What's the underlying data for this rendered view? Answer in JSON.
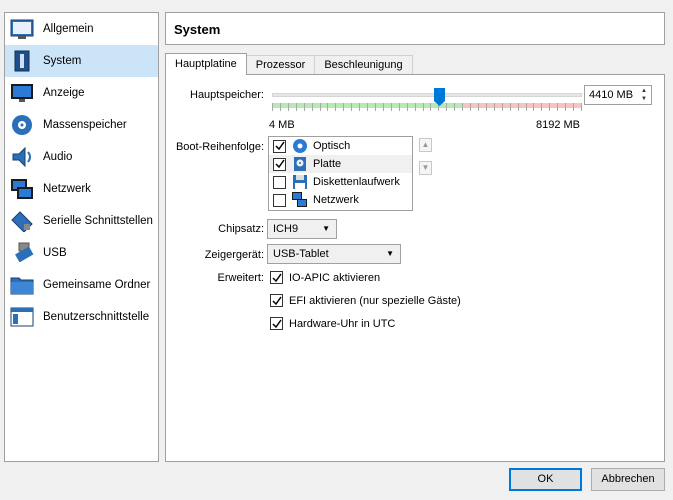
{
  "sidebar": {
    "items": [
      {
        "label": "Allgemein",
        "icon": "general-icon"
      },
      {
        "label": "System",
        "icon": "system-icon",
        "selected": true
      },
      {
        "label": "Anzeige",
        "icon": "display-icon"
      },
      {
        "label": "Massenspeicher",
        "icon": "storage-icon"
      },
      {
        "label": "Audio",
        "icon": "audio-icon"
      },
      {
        "label": "Netzwerk",
        "icon": "network-icon"
      },
      {
        "label": "Serielle Schnittstellen",
        "icon": "serial-port-icon"
      },
      {
        "label": "USB",
        "icon": "usb-icon"
      },
      {
        "label": "Gemeinsame Ordner",
        "icon": "shared-folder-icon"
      },
      {
        "label": "Benutzerschnittstelle",
        "icon": "user-interface-icon"
      }
    ]
  },
  "header": {
    "title": "System"
  },
  "tabs": [
    {
      "label": "Hauptplatine",
      "active": true
    },
    {
      "label": "Prozessor",
      "active": false
    },
    {
      "label": "Beschleunigung",
      "active": false
    }
  ],
  "motherboard": {
    "memory_label": "Hauptspeicher:",
    "memory_value": "4410 MB",
    "memory_min_label": "4 MB",
    "memory_max_label": "8192 MB",
    "memory_fraction": 0.538,
    "boot_order_label": "Boot-Reihenfolge:",
    "boot_items": [
      {
        "label": "Optisch",
        "checked": true,
        "icon": "optical-disc-icon"
      },
      {
        "label": "Platte",
        "checked": true,
        "icon": "hard-disk-icon"
      },
      {
        "label": "Diskettenlaufwerk",
        "checked": false,
        "icon": "floppy-icon"
      },
      {
        "label": "Netzwerk",
        "checked": false,
        "icon": "network-boot-icon"
      }
    ],
    "chipset_label": "Chipsatz:",
    "chipset_value": "ICH9",
    "pointer_label": "Zeigergerät:",
    "pointer_value": "USB-Tablet",
    "extended_label": "Erweitert:",
    "extended_options": [
      {
        "label": "IO-APIC aktivieren",
        "checked": true
      },
      {
        "label": "EFI aktivieren (nur spezielle Gäste)",
        "checked": true
      },
      {
        "label": "Hardware-Uhr in UTC",
        "checked": true
      }
    ]
  },
  "footer": {
    "ok_label": "OK",
    "cancel_label": "Abbrechen"
  },
  "colors": {
    "accent": "#0078d7",
    "selection": "#cce4f7",
    "slider_green": "#a8e6a0",
    "slider_red": "#f5b8b8"
  }
}
